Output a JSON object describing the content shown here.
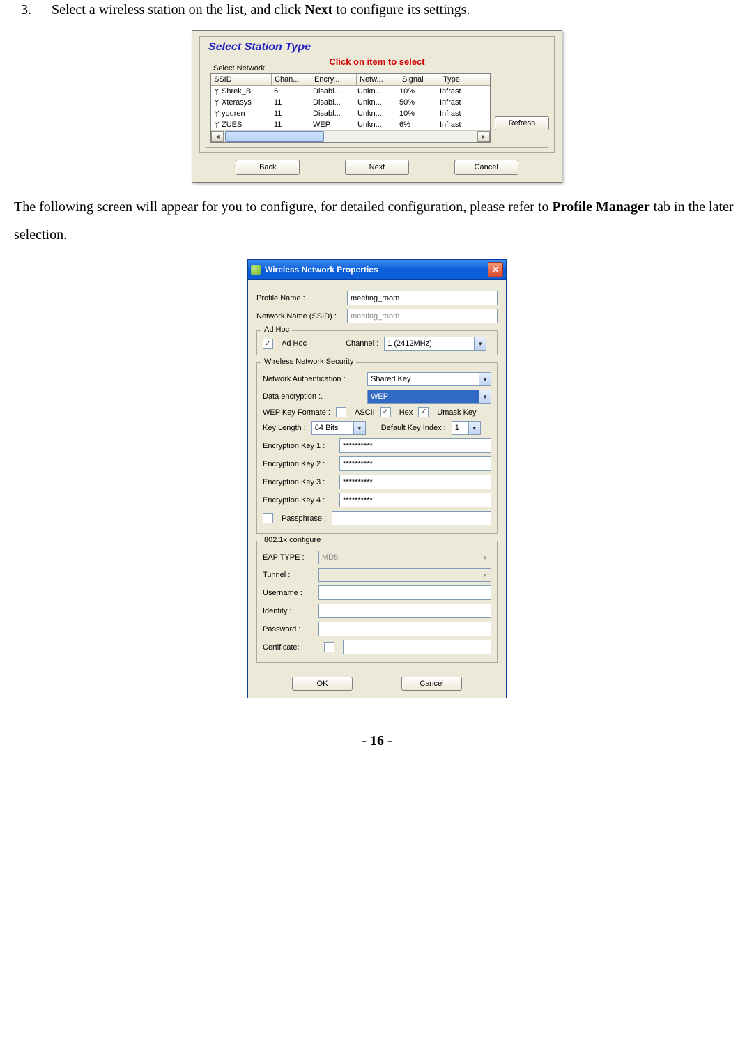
{
  "step": {
    "number": "3.",
    "text_before": "Select a wireless station on the list, and click ",
    "bold": "Next",
    "text_after": " to configure its settings."
  },
  "dlg1": {
    "title": "Select Station Type",
    "subtitle": "Click on item to select",
    "group_label": "Select Network",
    "headers": {
      "ssid": "SSID",
      "chan": "Chan...",
      "encr": "Encry...",
      "netw": "Netw...",
      "sig": "Signal",
      "type": "Type"
    },
    "rows": [
      {
        "ssid": "Shrek_B",
        "chan": "6",
        "encr": "Disabl...",
        "netw": "Unkn...",
        "sig": "10%",
        "type": "Infrast"
      },
      {
        "ssid": "Xterasys",
        "chan": "11",
        "encr": "Disabl...",
        "netw": "Unkn...",
        "sig": "50%",
        "type": "Infrast"
      },
      {
        "ssid": "youren",
        "chan": "11",
        "encr": "Disabl...",
        "netw": "Unkn...",
        "sig": "10%",
        "type": "Infrast"
      },
      {
        "ssid": "ZUES",
        "chan": "11",
        "encr": "WEP",
        "netw": "Unkn...",
        "sig": "6%",
        "type": "Infrast"
      }
    ],
    "refresh": "Refresh",
    "back": "Back",
    "next": "Next",
    "cancel": "Cancel"
  },
  "mid_text": {
    "part1": "The following screen will appear for you to configure, for detailed configuration, please refer to ",
    "bold": "Profile Manager",
    "part2": " tab in the later selection."
  },
  "dlg2": {
    "title": "Wireless Network Properties",
    "profile_name_label": "Profile Name :",
    "profile_name_value": "meeting_room",
    "ssid_label": "Network Name (SSID) :",
    "ssid_value": "meeting_room",
    "adhoc": {
      "group": "Ad Hoc",
      "checkbox_label": "Ad Hoc",
      "channel_label": "Channel :",
      "channel_value": "1  (2412MHz)"
    },
    "security": {
      "group": "Wireless Network Security",
      "auth_label": "Network Authentication :",
      "auth_value": "Shared Key",
      "enc_label": "Data encryption :.",
      "enc_value": "WEP",
      "wepfmt_label": "WEP Key Formate :",
      "ascii": "ASCII",
      "hex": "Hex",
      "umask": "Umask Key",
      "keylen_label": "Key Length :",
      "keylen_value": "64 Bits",
      "defidx_label": "Default Key Index :",
      "defidx_value": "1",
      "k1_label": "Encryption Key 1 :",
      "k1_value": "**********",
      "k2_label": "Encryption Key 2 :",
      "k2_value": "**********",
      "k3_label": "Encryption Key 3 :",
      "k3_value": "**********",
      "k4_label": "Encryption Key 4 :",
      "k4_value": "**********",
      "passphrase_label": "Passphrase :"
    },
    "dot1x": {
      "group": "802.1x configure",
      "eap_label": "EAP TYPE :",
      "eap_value": "MD5",
      "tunnel_label": "Tunnel :",
      "user_label": "Username :",
      "identity_label": "Identity :",
      "password_label": "Password :",
      "cert_label": "Certificate:"
    },
    "ok": "OK",
    "cancel": "Cancel"
  },
  "page_number": "- 16 -"
}
